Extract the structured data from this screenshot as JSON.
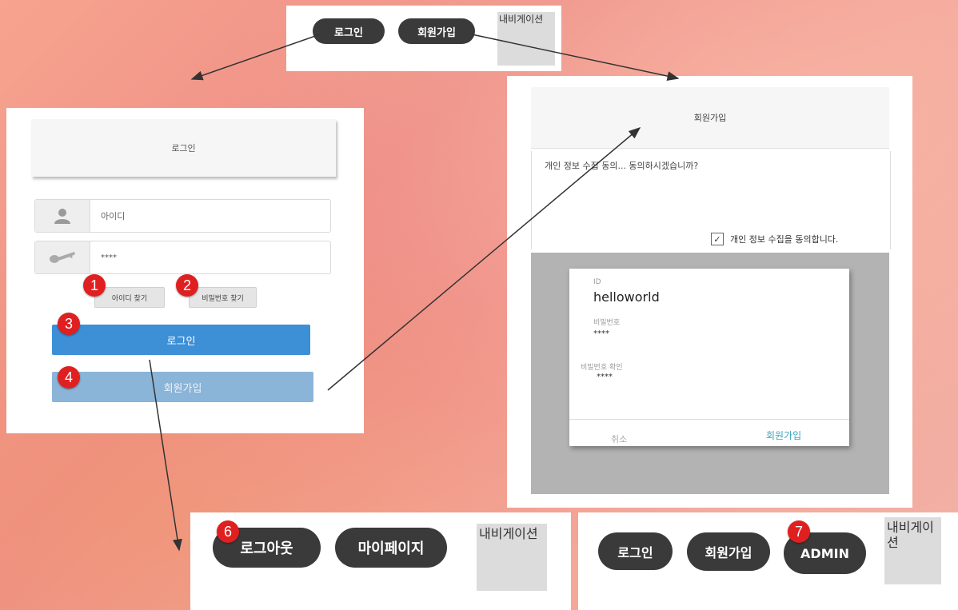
{
  "top_nav": {
    "login_label": "로그인",
    "signup_label": "회원가입",
    "nav_label": "내비게이션"
  },
  "login_panel": {
    "title": "로그인",
    "id_placeholder": "아이디",
    "password_value": "****",
    "find_id_label": "아이디 찾기",
    "find_pw_label": "비밀번호 찾기",
    "login_button": "로그인",
    "signup_button": "회원가입"
  },
  "signup_panel": {
    "title": "회원가입",
    "consent_text": "개인 정보 수집 동의... 동의하시겠습니까?",
    "consent_check_label": "개인 정보 수집을 동의합니다.",
    "id_label": "ID",
    "id_value": "helloworld",
    "pw_label": "비밀번호",
    "pw_value": "****",
    "pw_confirm_label": "비밀번호 확인",
    "pw_confirm_value": "****",
    "cancel_button": "취소",
    "signup_button": "회원가입"
  },
  "logged_in_nav": {
    "logout_label": "로그아웃",
    "mypage_label": "마이페이지",
    "nav_label": "내비게이션"
  },
  "admin_nav": {
    "login_label": "로그인",
    "signup_label": "회원가입",
    "admin_label": "ADMIN",
    "nav_label": "내비게이션"
  },
  "badges": [
    "1",
    "2",
    "3",
    "4",
    "6",
    "7"
  ],
  "colors": {
    "pill": "#3a3a3a",
    "login_blue": "#3d8fd6",
    "signup_blue": "#8ab4d8",
    "badge_red": "#e02020",
    "modal_accent": "#3aa6b9"
  }
}
